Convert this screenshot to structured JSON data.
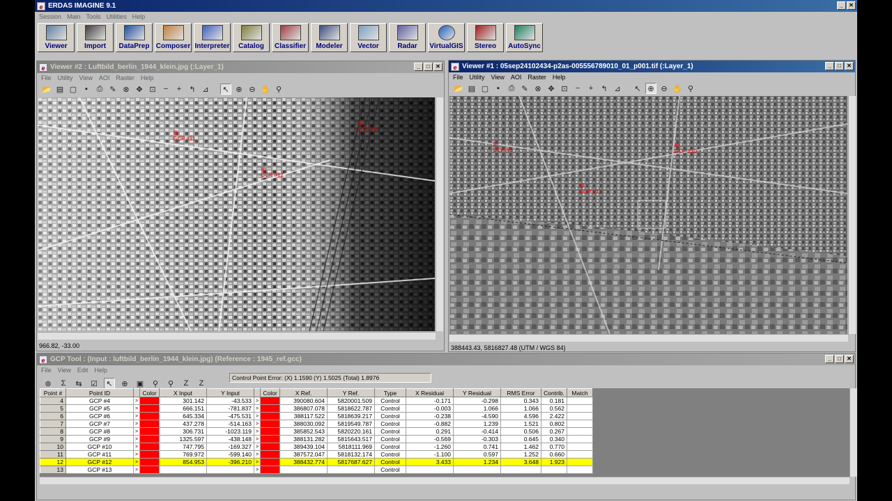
{
  "app": {
    "title": "ERDAS IMAGINE 9.1",
    "menu": [
      "Session",
      "Main",
      "Tools",
      "Utilities",
      "Help"
    ],
    "toolbar": [
      {
        "label": "Viewer",
        "icon": "viewer-icon"
      },
      {
        "label": "Import",
        "icon": "import-icon"
      },
      {
        "label": "DataPrep",
        "icon": "dataprep-icon"
      },
      {
        "label": "Composer",
        "icon": "composer-icon"
      },
      {
        "label": "Interpreter",
        "icon": "interpreter-icon"
      },
      {
        "label": "Catalog",
        "icon": "catalog-icon"
      },
      {
        "label": "Classifier",
        "icon": "classifier-icon"
      },
      {
        "label": "Modeler",
        "icon": "modeler-icon"
      },
      {
        "label": "Vector",
        "icon": "vector-icon"
      },
      {
        "label": "Radar",
        "icon": "radar-icon"
      },
      {
        "label": "VirtualGIS",
        "icon": "globe-icon"
      },
      {
        "label": "Stereo",
        "icon": "stereo-icon"
      },
      {
        "label": "AutoSync",
        "icon": "autosync-icon"
      }
    ]
  },
  "viewer2": {
    "title": "Viewer #2 : Luftbild_berlin_1944_klein.jpg (:Layer_1)",
    "menu": [
      "File",
      "Utility",
      "View",
      "AOI",
      "Raster",
      "Help"
    ],
    "status": "966.82, -33.00",
    "gcps": [
      {
        "id": "GCP #11"
      },
      {
        "id": "GCP #12"
      },
      {
        "id": "GCP #4"
      }
    ]
  },
  "viewer1": {
    "title": "Viewer #1 : 05sep24102434-p2as-005556789010_01_p001.tif (:Layer_1)",
    "menu": [
      "File",
      "Utility",
      "View",
      "AOI",
      "Raster",
      "Help"
    ],
    "status": "388443.43, 5816827.48  (UTM / WGS 84)",
    "gcps": [
      {
        "id": "GCP #9"
      },
      {
        "id": "GCP #10"
      },
      {
        "id": "GCP #12"
      }
    ]
  },
  "gcp_tool": {
    "title": "GCP Tool : (Input : luftbild_berlin_1944_klein.jpg) (Reference : 1945_ref.gcc)",
    "menu": [
      "File",
      "View",
      "Edit",
      "Help"
    ],
    "error": "Control Point Error: (X) 1.1590   (Y) 1.5025      (Total) 1.8976",
    "columns": [
      "Point #",
      "Point ID",
      "",
      "Color",
      "X Input",
      "Y Input",
      "",
      "Color",
      "X Ref.",
      "Y Ref.",
      "Type",
      "X Residual",
      "Y Residual",
      "RMS Error",
      "Contrib.",
      "Match"
    ],
    "rows": [
      {
        "n": "4",
        "id": "GCP #4",
        "xi": "301.142",
        "yi": "-43.533",
        "xr": "390080.604",
        "yr": "5820001.509",
        "type": "Control",
        "xres": "-0.171",
        "yres": "-0.298",
        "rms": "0.343",
        "con": "0.181"
      },
      {
        "n": "5",
        "id": "GCP #5",
        "xi": "666.151",
        "yi": "-781.837",
        "xr": "386807.078",
        "yr": "5818622.787",
        "type": "Control",
        "xres": "-0.003",
        "yres": "1.066",
        "rms": "1.066",
        "con": "0.562"
      },
      {
        "n": "6",
        "id": "GCP #6",
        "xi": "645.334",
        "yi": "-475.531",
        "xr": "388117.522",
        "yr": "5818639.217",
        "type": "Control",
        "xres": "-0.238",
        "yres": "-4.590",
        "rms": "4.596",
        "con": "2.422"
      },
      {
        "n": "7",
        "id": "GCP #7",
        "xi": "437.278",
        "yi": "-514.163",
        "xr": "388030.092",
        "yr": "5819549.787",
        "type": "Control",
        "xres": "-0.882",
        "yres": "1.239",
        "rms": "1.521",
        "con": "0.802"
      },
      {
        "n": "8",
        "id": "GCP #8",
        "xi": "306.731",
        "yi": "-1023.119",
        "xr": "385852.543",
        "yr": "5820220.161",
        "type": "Control",
        "xres": "0.291",
        "yres": "-0.414",
        "rms": "0.506",
        "con": "0.267"
      },
      {
        "n": "9",
        "id": "GCP #9",
        "xi": "1325.597",
        "yi": "-438.148",
        "xr": "388131.282",
        "yr": "5815643.517",
        "type": "Control",
        "xres": "-0.569",
        "yres": "-0.303",
        "rms": "0.645",
        "con": "0.340"
      },
      {
        "n": "10",
        "id": "GCP #10",
        "xi": "747.795",
        "yi": "-169.327",
        "xr": "389439.104",
        "yr": "5818111.969",
        "type": "Control",
        "xres": "-1.260",
        "yres": "0.741",
        "rms": "1.462",
        "con": "0.770"
      },
      {
        "n": "11",
        "id": "GCP #11",
        "xi": "769.972",
        "yi": "-599.140",
        "xr": "387572.047",
        "yr": "5818132.174",
        "type": "Control",
        "xres": "-1.100",
        "yres": "0.597",
        "rms": "1.252",
        "con": "0.660"
      },
      {
        "n": "12",
        "id": "GCP #12",
        "xi": "854.953",
        "yi": "-396.210",
        "xr": "388432.774",
        "yr": "5817687.627",
        "type": "Control",
        "xres": "3.433",
        "yres": "1.234",
        "rms": "3.648",
        "con": "1.923",
        "highlight": true
      },
      {
        "n": "13",
        "id": "GCP #13",
        "xi": "",
        "yi": "",
        "xr": "",
        "yr": "",
        "type": "Control",
        "xres": "",
        "yres": "",
        "rms": "",
        "con": ""
      }
    ]
  }
}
